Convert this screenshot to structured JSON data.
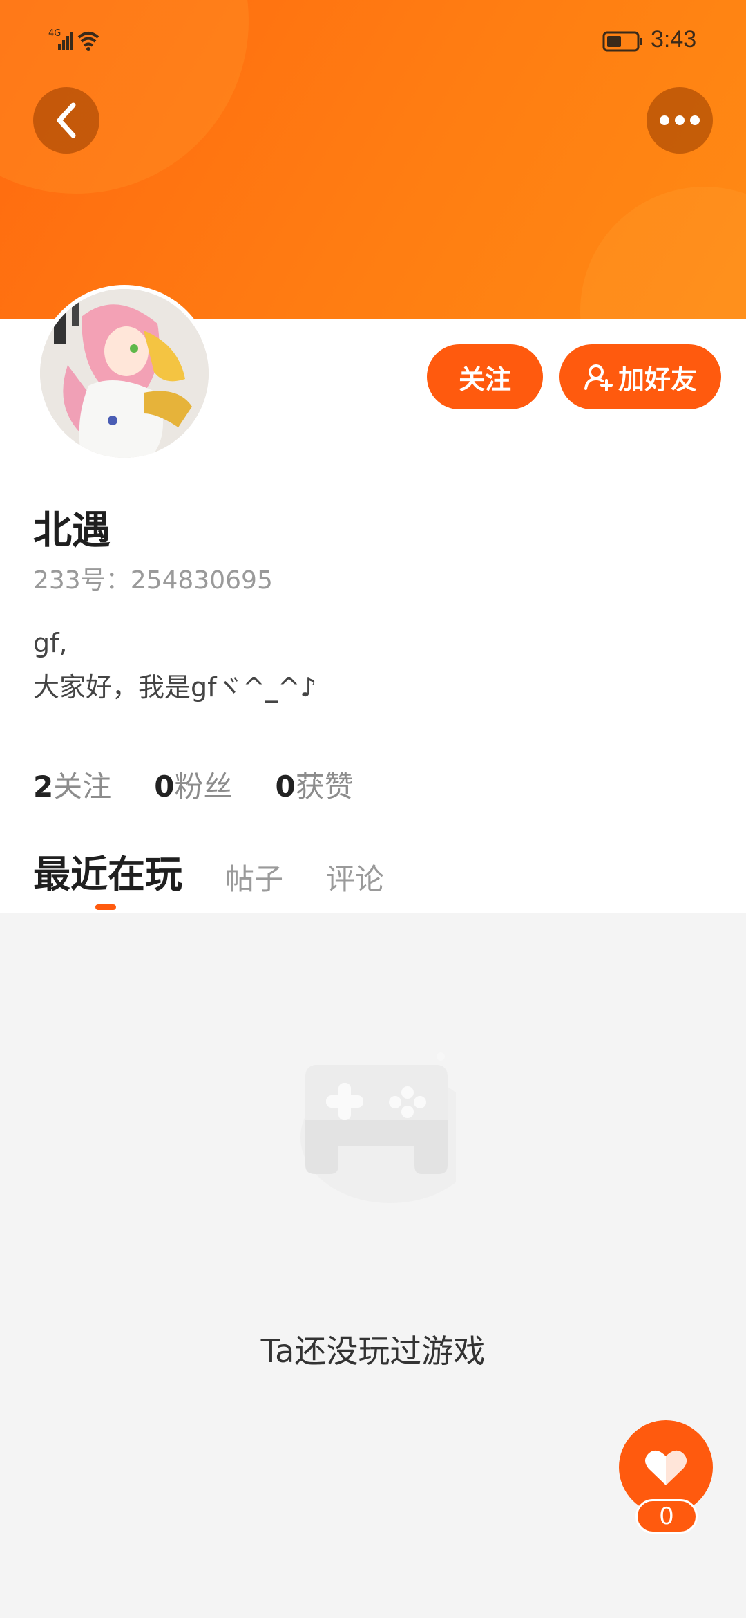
{
  "status_bar": {
    "network": "4G",
    "time": "3:43"
  },
  "profile": {
    "follow_label": "关注",
    "add_friend_label": "加好友",
    "username": "北遇",
    "user_id": "233号：254830695",
    "bio_line1": "gf,",
    "bio_line2": "大家好，我是gfヾ^_^♪"
  },
  "stats": {
    "following_count": "2",
    "following_label": "关注",
    "fans_count": "0",
    "fans_label": "粉丝",
    "likes_count": "0",
    "likes_label": "获赞"
  },
  "tabs": [
    {
      "label": "最近在玩",
      "active": true
    },
    {
      "label": "帖子",
      "active": false
    },
    {
      "label": "评论",
      "active": false
    }
  ],
  "empty_state": {
    "icon": "gamepad-icon",
    "message": "Ta还没玩过游戏"
  },
  "like_fab": {
    "icon": "heart-icon",
    "count": "0"
  },
  "colors": {
    "accent": "#ff5a0e",
    "header": "#ff7a12",
    "background": "#f4f4f4"
  }
}
